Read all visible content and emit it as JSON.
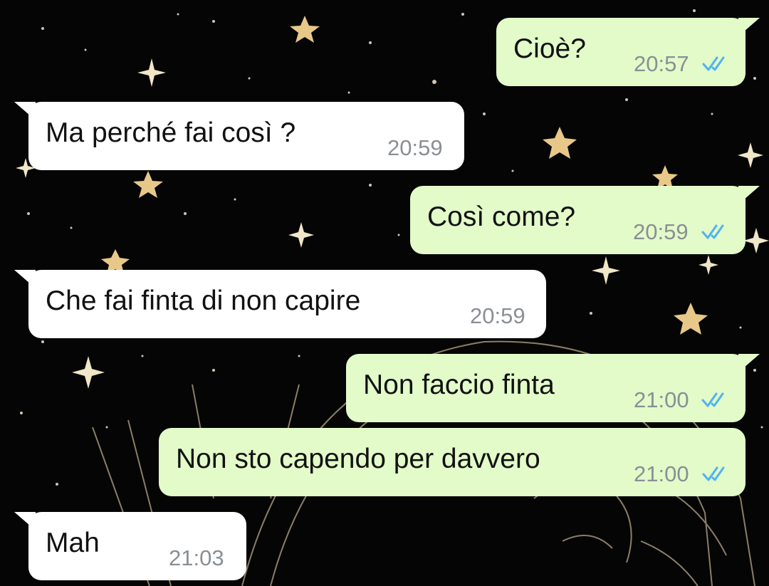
{
  "colors": {
    "incoming_bubble": "#ffffff",
    "outgoing_bubble": "#e2fbc9",
    "read_ticks": "#4fb3f0",
    "timestamp": "#8a8f94",
    "wallpaper": "#050505",
    "stars": "#e8c888"
  },
  "icons": {
    "read_receipt": "double-check-icon"
  },
  "messages": [
    {
      "direction": "outgoing",
      "text": "Cioè?",
      "time": "20:57",
      "status": "read"
    },
    {
      "direction": "incoming",
      "text": "Ma perché fai così ?",
      "time": "20:59"
    },
    {
      "direction": "outgoing",
      "text": "Così come?",
      "time": "20:59",
      "status": "read"
    },
    {
      "direction": "incoming",
      "text": "Che fai finta di non capire",
      "time": "20:59"
    },
    {
      "direction": "outgoing",
      "text": "Non faccio finta",
      "time": "21:00",
      "status": "read"
    },
    {
      "direction": "outgoing",
      "text": "Non sto capendo per davvero",
      "time": "21:00",
      "status": "read"
    },
    {
      "direction": "incoming",
      "text": "Mah",
      "time": "21:03"
    }
  ]
}
